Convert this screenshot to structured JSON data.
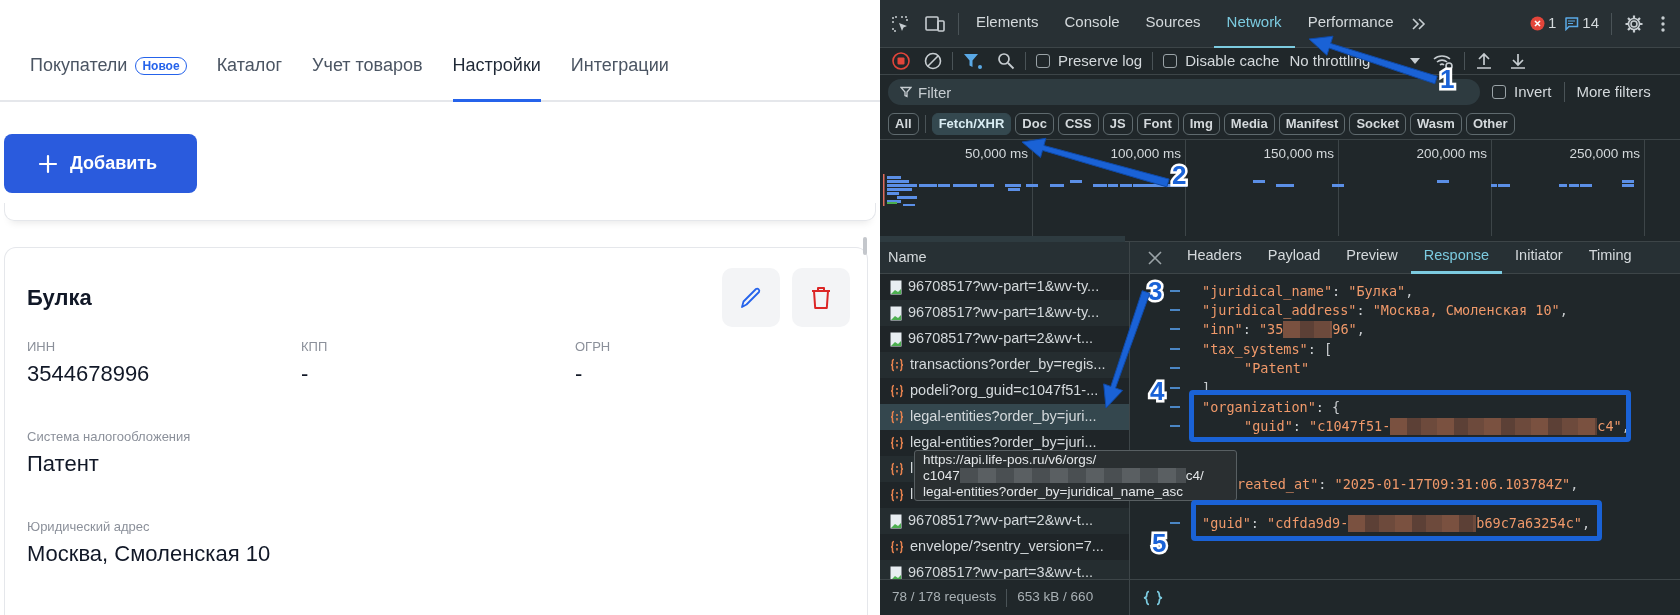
{
  "page": {
    "tabs": [
      {
        "label": "Покупатели",
        "badge": "Новое",
        "selected": false
      },
      {
        "label": "Каталог",
        "selected": false
      },
      {
        "label": "Учет товаров",
        "selected": false
      },
      {
        "label": "Настройки",
        "selected": true
      },
      {
        "label": "Интеграции",
        "selected": false
      }
    ],
    "add_button": "Добавить",
    "entity": {
      "title": "Булка",
      "field_rows": [
        [
          {
            "label": "ИНН",
            "value": "3544678996"
          },
          {
            "label": "КПП",
            "value": "-"
          },
          {
            "label": "ОГРН",
            "value": "-"
          }
        ],
        [
          {
            "label": "Система налогообложения",
            "value": "Патент"
          }
        ],
        [
          {
            "label": "Юридический адрес",
            "value": "Москва, Смоленская 10"
          }
        ]
      ]
    }
  },
  "devtools": {
    "panel_tabs": [
      {
        "label": "Elements",
        "selected": false
      },
      {
        "label": "Console",
        "selected": false
      },
      {
        "label": "Sources",
        "selected": false
      },
      {
        "label": "Network",
        "selected": true
      },
      {
        "label": "Performance",
        "selected": false
      }
    ],
    "errors": "1",
    "messages": "14",
    "toolbar": {
      "preserve_log": {
        "label": "Preserve log",
        "checked": false
      },
      "disable_cache": {
        "label": "Disable cache",
        "checked": false
      },
      "throttling": "No throttling"
    },
    "filter": {
      "placeholder": "Filter",
      "invert": {
        "label": "Invert",
        "checked": false
      },
      "more_filters": "More filters"
    },
    "types": [
      {
        "label": "All",
        "selected": false
      },
      {
        "label": "Fetch/XHR",
        "selected": true
      },
      {
        "label": "Doc",
        "selected": false
      },
      {
        "label": "CSS",
        "selected": false
      },
      {
        "label": "JS",
        "selected": false
      },
      {
        "label": "Font",
        "selected": false
      },
      {
        "label": "Img",
        "selected": false
      },
      {
        "label": "Media",
        "selected": false
      },
      {
        "label": "Manifest",
        "selected": false
      },
      {
        "label": "Socket",
        "selected": false
      },
      {
        "label": "Wasm",
        "selected": false
      },
      {
        "label": "Other",
        "selected": false
      }
    ],
    "timeline_ticks": [
      "50,000 ms",
      "100,000 ms",
      "150,000 ms",
      "200,000 ms",
      "250,000 ms"
    ],
    "requests": {
      "column": "Name",
      "rows": [
        {
          "kind": "image",
          "name": "96708517?wv-part=1&wv-ty...",
          "selected": false
        },
        {
          "kind": "image",
          "name": "96708517?wv-part=1&wv-ty...",
          "selected": false
        },
        {
          "kind": "image",
          "name": "96708517?wv-part=2&wv-t...",
          "selected": false
        },
        {
          "kind": "fetch",
          "name": "transactions?order_by=regis...",
          "selected": false
        },
        {
          "kind": "fetch",
          "name": "podeli?org_guid=c1047f51-...",
          "selected": false
        },
        {
          "kind": "fetch",
          "name": "legal-entities?order_by=juri...",
          "selected": true
        },
        {
          "kind": "fetch",
          "name": "legal-entities?order_by=juri...",
          "selected": false
        },
        {
          "kind": "fetch",
          "name": "l",
          "selected": false
        },
        {
          "kind": "fetch",
          "name": "l",
          "selected": false
        },
        {
          "kind": "image",
          "name": "96708517?wv-part=2&wv-t...",
          "selected": false
        },
        {
          "kind": "fetch",
          "name": "envelope/?sentry_version=7...",
          "selected": false
        },
        {
          "kind": "image",
          "name": "96708517?wv-part=3&wv-t...",
          "selected": false
        }
      ],
      "summary": "78 / 178 requests",
      "transferred": "653 kB / 660"
    },
    "tooltip": {
      "lines": [
        {
          "segments": [
            {
              "kind": "text",
              "text": "https://api.life-pos.ru/v6/orgs/"
            }
          ]
        },
        {
          "segments": [
            {
              "kind": "text",
              "text": "c1047"
            },
            {
              "kind": "redacted"
            },
            {
              "kind": "text",
              "text": "c4/"
            }
          ]
        },
        {
          "segments": [
            {
              "kind": "text",
              "text": "legal-entities?order_by=juridical_name_asc"
            }
          ]
        }
      ]
    },
    "detail_tabs": [
      {
        "label": "Headers",
        "selected": false
      },
      {
        "label": "Payload",
        "selected": false
      },
      {
        "label": "Preview",
        "selected": false
      },
      {
        "label": "Response",
        "selected": true
      },
      {
        "label": "Initiator",
        "selected": false
      },
      {
        "label": "Timing",
        "selected": false
      }
    ],
    "response_lines": [
      {
        "kind": "code",
        "segments": [
          {
            "kind": "key",
            "text": "\"juridical_name\""
          },
          {
            "kind": "punct",
            "text": ": "
          },
          {
            "kind": "str",
            "text": "\"Булка\""
          },
          {
            "kind": "punct",
            "text": ","
          }
        ]
      },
      {
        "kind": "code",
        "segments": [
          {
            "kind": "key",
            "text": "\"juridical_address\""
          },
          {
            "kind": "punct",
            "text": ": "
          },
          {
            "kind": "str",
            "text": "\"Москва, Смоленская 10\""
          },
          {
            "kind": "punct",
            "text": ","
          }
        ]
      },
      {
        "kind": "code",
        "segments": [
          {
            "kind": "key",
            "text": "\"inn\""
          },
          {
            "kind": "punct",
            "text": ": "
          },
          {
            "kind": "str",
            "text": "\"35"
          },
          {
            "kind": "redacted"
          },
          {
            "kind": "str",
            "text": "96\""
          },
          {
            "kind": "punct",
            "text": ","
          }
        ]
      },
      {
        "kind": "code",
        "segments": [
          {
            "kind": "key",
            "text": "\"tax_systems\""
          },
          {
            "kind": "punct",
            "text": ": ["
          }
        ]
      },
      {
        "kind": "indented",
        "segments": [
          {
            "kind": "str",
            "text": "\"Patent\""
          }
        ]
      },
      {
        "kind": "code",
        "segments": [
          {
            "kind": "punct",
            "text": "]"
          }
        ]
      },
      {
        "kind": "code",
        "segments": [
          {
            "kind": "key",
            "text": "\"organization\""
          },
          {
            "kind": "punct",
            "text": ": {"
          }
        ]
      },
      {
        "kind": "indented",
        "segments": [
          {
            "kind": "key",
            "text": "\"guid\""
          },
          {
            "kind": "punct",
            "text": ": "
          },
          {
            "kind": "str",
            "text": "\"c1047f51-"
          },
          {
            "kind": "redacted"
          },
          {
            "kind": "str",
            "text": "c4\""
          },
          {
            "kind": "punct",
            "text": ","
          }
        ]
      },
      {
        "kind": "obscured"
      },
      {
        "kind": "obscured"
      },
      {
        "kind": "partly_covered",
        "segments": [
          {
            "kind": "key",
            "text": "reated_at\""
          },
          {
            "kind": "punct",
            "text": ": "
          },
          {
            "kind": "str",
            "text": "\"2025-01-17T09:31:06.103784Z\""
          },
          {
            "kind": "punct",
            "text": ","
          }
        ]
      },
      {
        "kind": "obscured"
      },
      {
        "kind": "code",
        "segments": [
          {
            "kind": "key",
            "text": "\"guid\""
          },
          {
            "kind": "punct",
            "text": ": "
          },
          {
            "kind": "str",
            "text": "\"cdfda9d9-"
          },
          {
            "kind": "redacted"
          },
          {
            "kind": "str",
            "text": "b69c7a63254c\""
          },
          {
            "kind": "punct",
            "text": ","
          }
        ]
      },
      {
        "kind": "obscured"
      }
    ]
  },
  "annotations": [
    {
      "kind": "arrow",
      "number": "1"
    },
    {
      "kind": "arrow",
      "number": "2"
    },
    {
      "kind": "arrow",
      "number": "3"
    },
    {
      "kind": "box",
      "number": "4"
    },
    {
      "kind": "box",
      "number": "5"
    }
  ]
}
